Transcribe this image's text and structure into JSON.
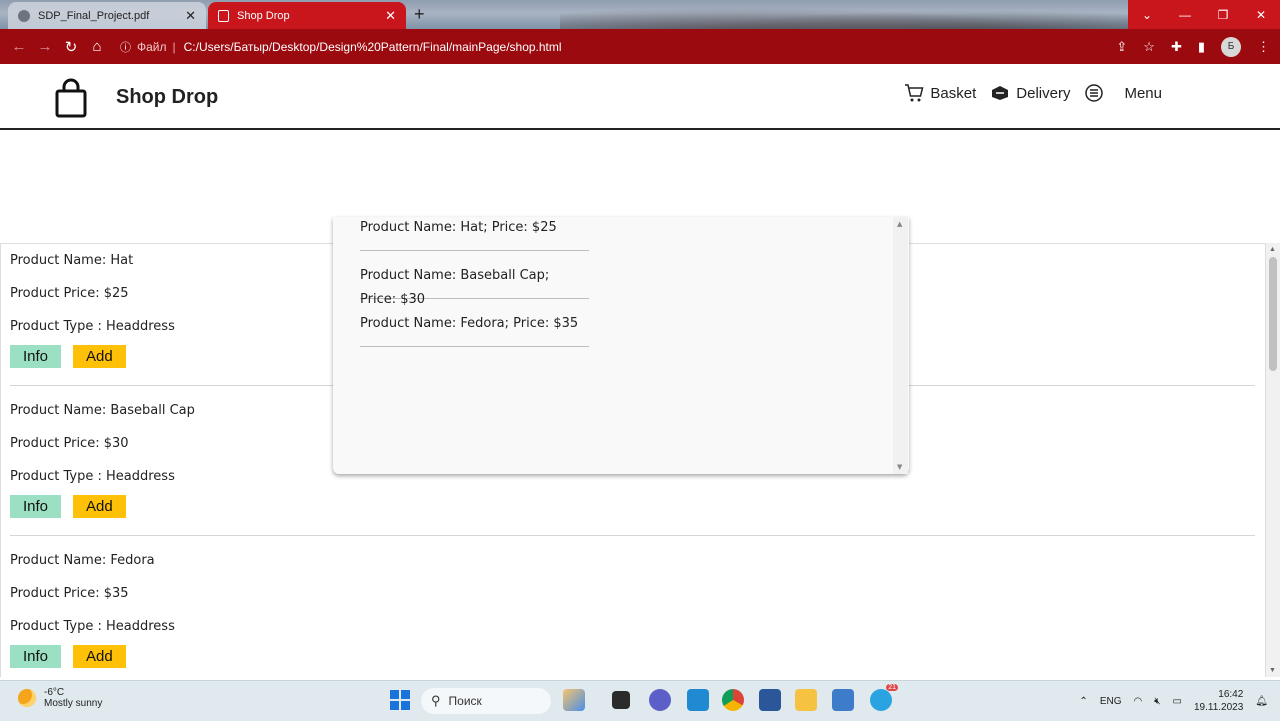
{
  "browser": {
    "tabs": [
      {
        "title": "SDP_Final_Project.pdf",
        "active": false
      },
      {
        "title": "Shop Drop",
        "active": true
      }
    ],
    "address": {
      "scheme_label": "Файл",
      "url": "C:/Users/Батыр/Desktop/Design%20Pattern/Final/mainPage/shop.html"
    },
    "profile_initial": "Б",
    "theme_color": "#9b0a0f"
  },
  "header": {
    "brand": "Shop Drop",
    "nav": [
      {
        "label": "Basket",
        "icon": "cart-icon"
      },
      {
        "label": "Delivery",
        "icon": "delivery-icon"
      },
      {
        "label": "Menu",
        "icon": "menu-icon"
      }
    ]
  },
  "basket_dropdown": {
    "items": [
      "Product Name: Hat; Price: $25",
      "Product Name: Baseball Cap; Price: $30",
      "Product Name: Fedora; Price: $35"
    ]
  },
  "products": [
    {
      "name": "Product Name: Hat",
      "price": "Product Price: $25",
      "type": "Product Type : Headdress",
      "info_label": "Info",
      "add_label": "Add"
    },
    {
      "name": "Product Name: Baseball Cap",
      "price": "Product Price: $30",
      "type": "Product Type : Headdress",
      "info_label": "Info",
      "add_label": "Add"
    },
    {
      "name": "Product Name: Fedora",
      "price": "Product Price: $35",
      "type": "Product Type : Headdress",
      "info_label": "Info",
      "add_label": "Add"
    }
  ],
  "colors": {
    "info_button": "#9be0c3",
    "add_button": "#ffc107"
  },
  "taskbar": {
    "weather_temp": "-6°C",
    "weather_desc": "Mostly sunny",
    "search_placeholder": "Поиск",
    "language": "ENG",
    "time": "16:42",
    "date": "19.11.2023",
    "telegram_badge": "21"
  }
}
